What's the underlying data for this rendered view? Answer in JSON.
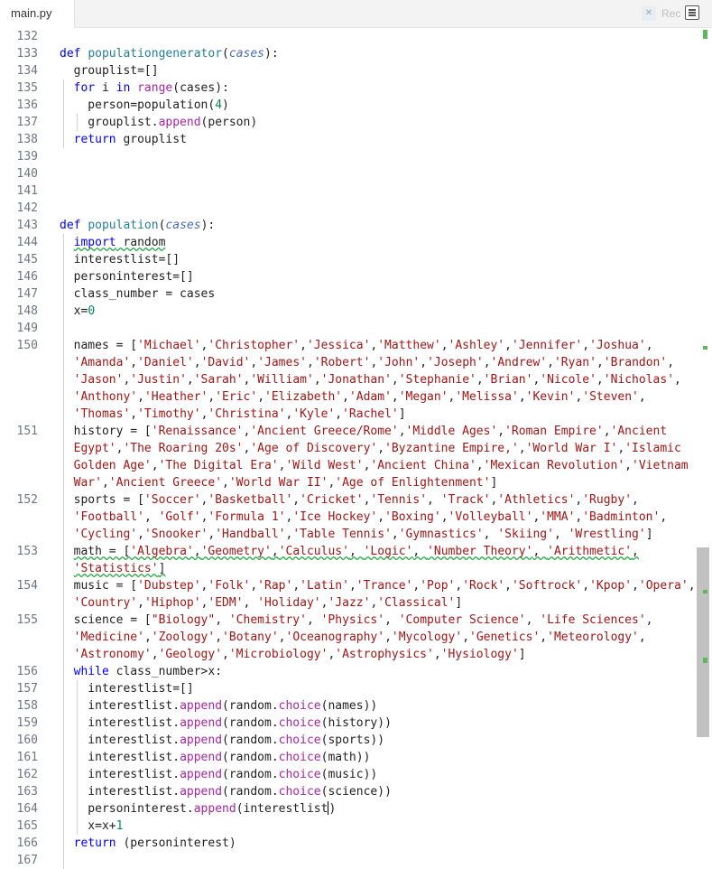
{
  "tab": {
    "filename": "main.py"
  },
  "toolbar": {
    "right_label": "Rec",
    "menu_icon": "menu-icon"
  },
  "lines": [
    {
      "n": "132",
      "html": ""
    },
    {
      "n": "133",
      "html": "<span class=\"kw\">def</span> <span class=\"fn\">populationgenerator</span>(<span class=\"pa\">cases</span>):"
    },
    {
      "n": "134",
      "html": "  grouplist=[]"
    },
    {
      "n": "135",
      "html": "  <span class=\"kw\">for</span> i <span class=\"kw\">in</span> <span class=\"bi\">range</span>(cases):"
    },
    {
      "n": "136",
      "html": "    person=population(<span class=\"num\">4</span>)"
    },
    {
      "n": "137",
      "html": "    grouplist.<span class=\"bi\">append</span>(person)"
    },
    {
      "n": "138",
      "html": "  <span class=\"kw\">return</span> grouplist"
    },
    {
      "n": "139",
      "html": ""
    },
    {
      "n": "140",
      "html": ""
    },
    {
      "n": "141",
      "html": ""
    },
    {
      "n": "142",
      "html": ""
    },
    {
      "n": "143",
      "html": "<span class=\"kw\">def</span> <span class=\"fn\">population</span>(<span class=\"pa\">cases</span>):"
    },
    {
      "n": "144",
      "html": "  <span class=\"squig\"><span class=\"kw\">import</span> random</span>"
    },
    {
      "n": "145",
      "html": "  interestlist=[]"
    },
    {
      "n": "146",
      "html": "  personinterest=[]"
    },
    {
      "n": "147",
      "html": "  class_number = cases"
    },
    {
      "n": "148",
      "html": "  x=<span class=\"num\">0</span>"
    },
    {
      "n": "149",
      "html": ""
    },
    {
      "n": "150",
      "html": "  names = [<span class=\"str\">'Michael'</span>,<span class=\"str\">'Christopher'</span>,<span class=\"str\">'Jessica'</span>,<span class=\"str\">'Matthew'</span>,<span class=\"str\">'Ashley'</span>,<span class=\"str\">'Jennifer'</span>,<span class=\"str\">'Joshua'</span>,"
    },
    {
      "n": "",
      "html": "  <span class=\"str\">'Amanda'</span>,<span class=\"str\">'Daniel'</span>,<span class=\"str\">'David'</span>,<span class=\"str\">'James'</span>,<span class=\"str\">'Robert'</span>,<span class=\"str\">'John'</span>,<span class=\"str\">'Joseph'</span>,<span class=\"str\">'Andrew'</span>,<span class=\"str\">'Ryan'</span>,<span class=\"str\">'Brandon'</span>,"
    },
    {
      "n": "",
      "html": "  <span class=\"str\">'Jason'</span>,<span class=\"str\">'Justin'</span>,<span class=\"str\">'Sarah'</span>,<span class=\"str\">'William'</span>,<span class=\"str\">'Jonathan'</span>,<span class=\"str\">'Stephanie'</span>,<span class=\"str\">'Brian'</span>,<span class=\"str\">'Nicole'</span>,<span class=\"str\">'Nicholas'</span>,"
    },
    {
      "n": "",
      "html": "  <span class=\"str\">'Anthony'</span>,<span class=\"str\">'Heather'</span>,<span class=\"str\">'Eric'</span>,<span class=\"str\">'Elizabeth'</span>,<span class=\"str\">'Adam'</span>,<span class=\"str\">'Megan'</span>,<span class=\"str\">'Melissa'</span>,<span class=\"str\">'Kevin'</span>,<span class=\"str\">'Steven'</span>,"
    },
    {
      "n": "",
      "html": "  <span class=\"str\">'Thomas'</span>,<span class=\"str\">'Timothy'</span>,<span class=\"str\">'Christina'</span>,<span class=\"str\">'Kyle'</span>,<span class=\"str\">'Rachel'</span>]"
    },
    {
      "n": "151",
      "html": "  history = [<span class=\"str\">'Renaissance'</span>,<span class=\"str\">'Ancient Greece/Rome'</span>,<span class=\"str\">'Middle Ages'</span>,<span class=\"str\">'Roman Empire'</span>,<span class=\"str\">'Ancient</span>"
    },
    {
      "n": "",
      "html": "  <span class=\"str\">Egypt'</span>,<span class=\"str\">'The Roaring 20s'</span>,<span class=\"str\">'Age of Discovery'</span>,<span class=\"str\">'Byzantine Empire,'</span>,<span class=\"str\">'World War I'</span>,<span class=\"str\">'Islamic</span>"
    },
    {
      "n": "",
      "html": "  <span class=\"str\">Golden Age'</span>,<span class=\"str\">'The Digital Era'</span>,<span class=\"str\">'Wild West'</span>,<span class=\"str\">'Ancient China'</span>,<span class=\"str\">'Mexican Revolution'</span>,<span class=\"str\">'Vietnam</span>"
    },
    {
      "n": "",
      "html": "  <span class=\"str\">War'</span>,<span class=\"str\">'Ancient Greece'</span>,<span class=\"str\">'World War II'</span>,<span class=\"str\">'Age of Enlightenment'</span>]"
    },
    {
      "n": "152",
      "html": "  sports = [<span class=\"str\">'Soccer'</span>,<span class=\"str\">'Basketball'</span>,<span class=\"str\">'Cricket'</span>,<span class=\"str\">'Tennis'</span>, <span class=\"str\">'Track'</span>,<span class=\"str\">'Athletics'</span>,<span class=\"str\">'Rugby'</span>,"
    },
    {
      "n": "",
      "html": "  <span class=\"str\">'Football'</span>, <span class=\"str\">'Golf'</span>,<span class=\"str\">'Formula 1'</span>,<span class=\"str\">'Ice Hockey'</span>,<span class=\"str\">'Boxing'</span>,<span class=\"str\">'Volleyball'</span>,<span class=\"str\">'MMA'</span>,<span class=\"str\">'Badminton'</span>,"
    },
    {
      "n": "",
      "html": "  <span class=\"str\">'Cycling'</span>,<span class=\"str\">'Snooker'</span>,<span class=\"str\">'Handball'</span>,<span class=\"str\">'Table Tennis'</span>,<span class=\"str\">'Gymnastics'</span>, <span class=\"str\">'Skiing'</span>, <span class=\"str\">'Wrestling'</span>]"
    },
    {
      "n": "153",
      "html": "  <span class=\"squig\">math = [<span class=\"str\">'Algebra'</span>,<span class=\"str\">'Geometry'</span>,<span class=\"str\">'Calculus'</span>, <span class=\"str\">'Logic'</span>, <span class=\"str\">'Number Theory'</span>, <span class=\"str\">'Arithmetic'</span>,</span>"
    },
    {
      "n": "",
      "html": "  <span class=\"squig\"><span class=\"str\">'Statistics'</span>]</span>"
    },
    {
      "n": "154",
      "html": "  music = [<span class=\"str\">'Dubstep'</span>,<span class=\"str\">'Folk'</span>,<span class=\"str\">'Rap'</span>,<span class=\"str\">'Latin'</span>,<span class=\"str\">'Trance'</span>,<span class=\"str\">'Pop'</span>,<span class=\"str\">'Rock'</span>,<span class=\"str\">'Softrock'</span>,<span class=\"str\">'Kpop'</span>,<span class=\"str\">'Opera'</span>,"
    },
    {
      "n": "",
      "html": "  <span class=\"str\">'Country'</span>,<span class=\"str\">'Hiphop'</span>,<span class=\"str\">'EDM'</span>, <span class=\"str\">'Holiday'</span>,<span class=\"str\">'Jazz'</span>,<span class=\"str\">'Classical'</span>]"
    },
    {
      "n": "155",
      "html": "  science = [<span class=\"str\">\"Biology\"</span>, <span class=\"str\">'Chemistry'</span>, <span class=\"str\">'Physics'</span>, <span class=\"str\">'Computer Science'</span>, <span class=\"str\">'Life Sciences'</span>,"
    },
    {
      "n": "",
      "html": "  <span class=\"str\">'Medicine'</span>,<span class=\"str\">'Zoology'</span>,<span class=\"str\">'Botany'</span>,<span class=\"str\">'Oceanography'</span>,<span class=\"str\">'Mycology'</span>,<span class=\"str\">'Genetics'</span>,<span class=\"str\">'Meteorology'</span>,"
    },
    {
      "n": "",
      "html": "  <span class=\"str\">'Astronomy'</span>,<span class=\"str\">'Geology'</span>,<span class=\"str\">'Microbiology'</span>,<span class=\"str\">'Astrophysics'</span>,<span class=\"str\">'Hysiology'</span>]"
    },
    {
      "n": "156",
      "html": "  <span class=\"kw\">while</span> class_number>x:"
    },
    {
      "n": "157",
      "html": "    interestlist=[]"
    },
    {
      "n": "158",
      "html": "    interestlist.<span class=\"bi\">append</span>(random.<span class=\"bi\">choice</span>(names))"
    },
    {
      "n": "159",
      "html": "    interestlist.<span class=\"bi\">append</span>(random.<span class=\"bi\">choice</span>(history))"
    },
    {
      "n": "160",
      "html": "    interestlist.<span class=\"bi\">append</span>(random.<span class=\"bi\">choice</span>(sports))"
    },
    {
      "n": "161",
      "html": "    interestlist.<span class=\"bi\">append</span>(random.<span class=\"bi\">choice</span>(math))"
    },
    {
      "n": "162",
      "html": "    interestlist.<span class=\"bi\">append</span>(random.<span class=\"bi\">choice</span>(music))"
    },
    {
      "n": "163",
      "html": "    interestlist.<span class=\"bi\">append</span>(random.<span class=\"bi\">choice</span>(science))"
    },
    {
      "n": "164",
      "html": "    personinterest.<span class=\"bi\">append</span>(interestlist<span class=\"cursor\"></span>)"
    },
    {
      "n": "165",
      "html": "    x=x+<span class=\"num\">1</span>"
    },
    {
      "n": "166",
      "html": "  <span class=\"kw\">return</span> (personinterest)"
    },
    {
      "n": "167",
      "html": ""
    }
  ]
}
